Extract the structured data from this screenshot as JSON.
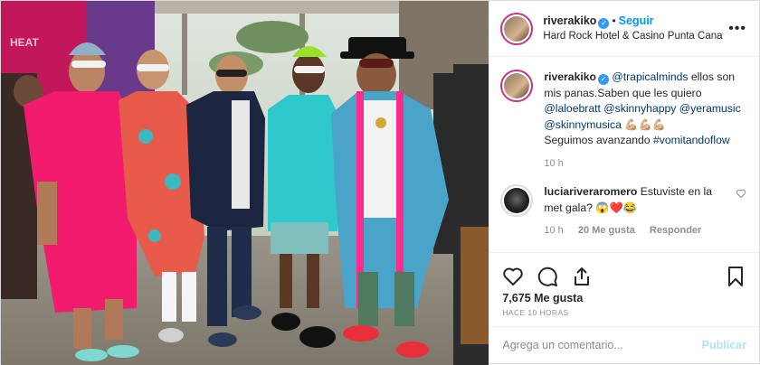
{
  "colors": {
    "accent": "#0095f6",
    "verified": "#3897f0",
    "link": "#00376b",
    "muted": "#8e8e8e"
  },
  "header": {
    "username": "riverakiko",
    "follow_label": "Seguir",
    "location": "Hard Rock Hotel & Casino Punta Cana",
    "more_icon": "more-horizontal-icon"
  },
  "caption": {
    "username": "riverakiko",
    "mention1": "@trapicalminds",
    "text1": " ellos son mis panas.Saben que les quiero ",
    "mention2": "@laloebratt",
    "mention3": "@skinnyhappy",
    "mention4": "@yeramusic",
    "mention5": "@skinnymusica",
    "emoji": "💪🏼💪🏼💪🏼",
    "text2": "Seguimos avanzando ",
    "hashtag": "#vomitandoflow",
    "time": "10 h"
  },
  "comment": {
    "username": "luciariveraromero",
    "text": " Estuviste en la met gala? 😱❤️😂",
    "time": "10 h",
    "likes": "20 Me gusta",
    "reply": "Responder"
  },
  "actions": {
    "like_icon": "heart-icon",
    "comment_icon": "comment-icon",
    "share_icon": "share-icon",
    "save_icon": "bookmark-icon"
  },
  "likes": "7,675 Me gusta",
  "ago": "HACE 10 HORAS",
  "add_comment": {
    "placeholder": "Agrega un comentario...",
    "publish": "Publicar"
  },
  "photo": {
    "sign_text": "HEAT"
  }
}
